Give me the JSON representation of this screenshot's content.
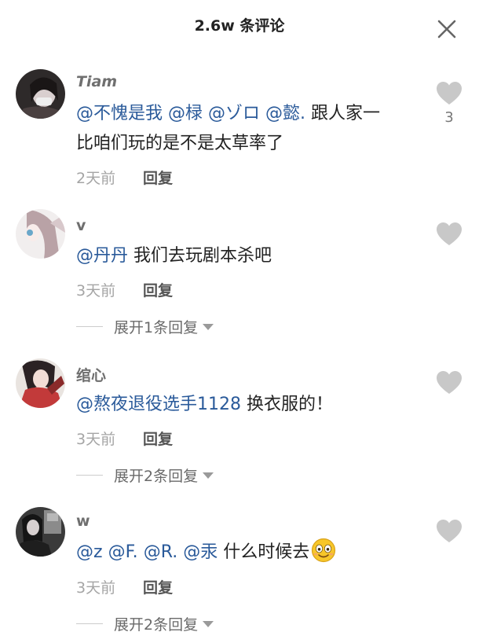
{
  "header": {
    "title": "2.6w 条评论"
  },
  "comments": [
    {
      "username": "Tiam",
      "mentions": [
        "@不愧是我",
        "@椂",
        "@ゾロ",
        "@懿."
      ],
      "text_line1_tail": "跟人家一",
      "text_line2": "比咱们玩的是不是太草率了",
      "time": "2天前",
      "reply_label": "回复",
      "like_count": "3"
    },
    {
      "username": "v",
      "mentions": [
        "@丹丹"
      ],
      "text": "我们去玩剧本杀吧",
      "time": "3天前",
      "reply_label": "回复",
      "expand_label": "展开1条回复"
    },
    {
      "username": "绾心",
      "mentions": [
        "@熬夜退役选手1128"
      ],
      "text": "换衣服的！",
      "time": "3天前",
      "reply_label": "回复",
      "expand_label": "展开2条回复"
    },
    {
      "username": "w",
      "mentions": [
        "@z",
        "@F.",
        "@R.",
        "@汞"
      ],
      "text": "什么时候去",
      "time": "3天前",
      "reply_label": "回复",
      "expand_label": "展开2条回复",
      "emoji": "smiling-emoji"
    }
  ],
  "colors": {
    "mention": "#2a5a9a",
    "meta": "#a5a5a5",
    "like_heart": "#c8c8c8",
    "username": "#6f6f6f"
  },
  "icons": {
    "close": "close-icon",
    "like": "heart-icon",
    "expand": "caret-down-icon"
  }
}
